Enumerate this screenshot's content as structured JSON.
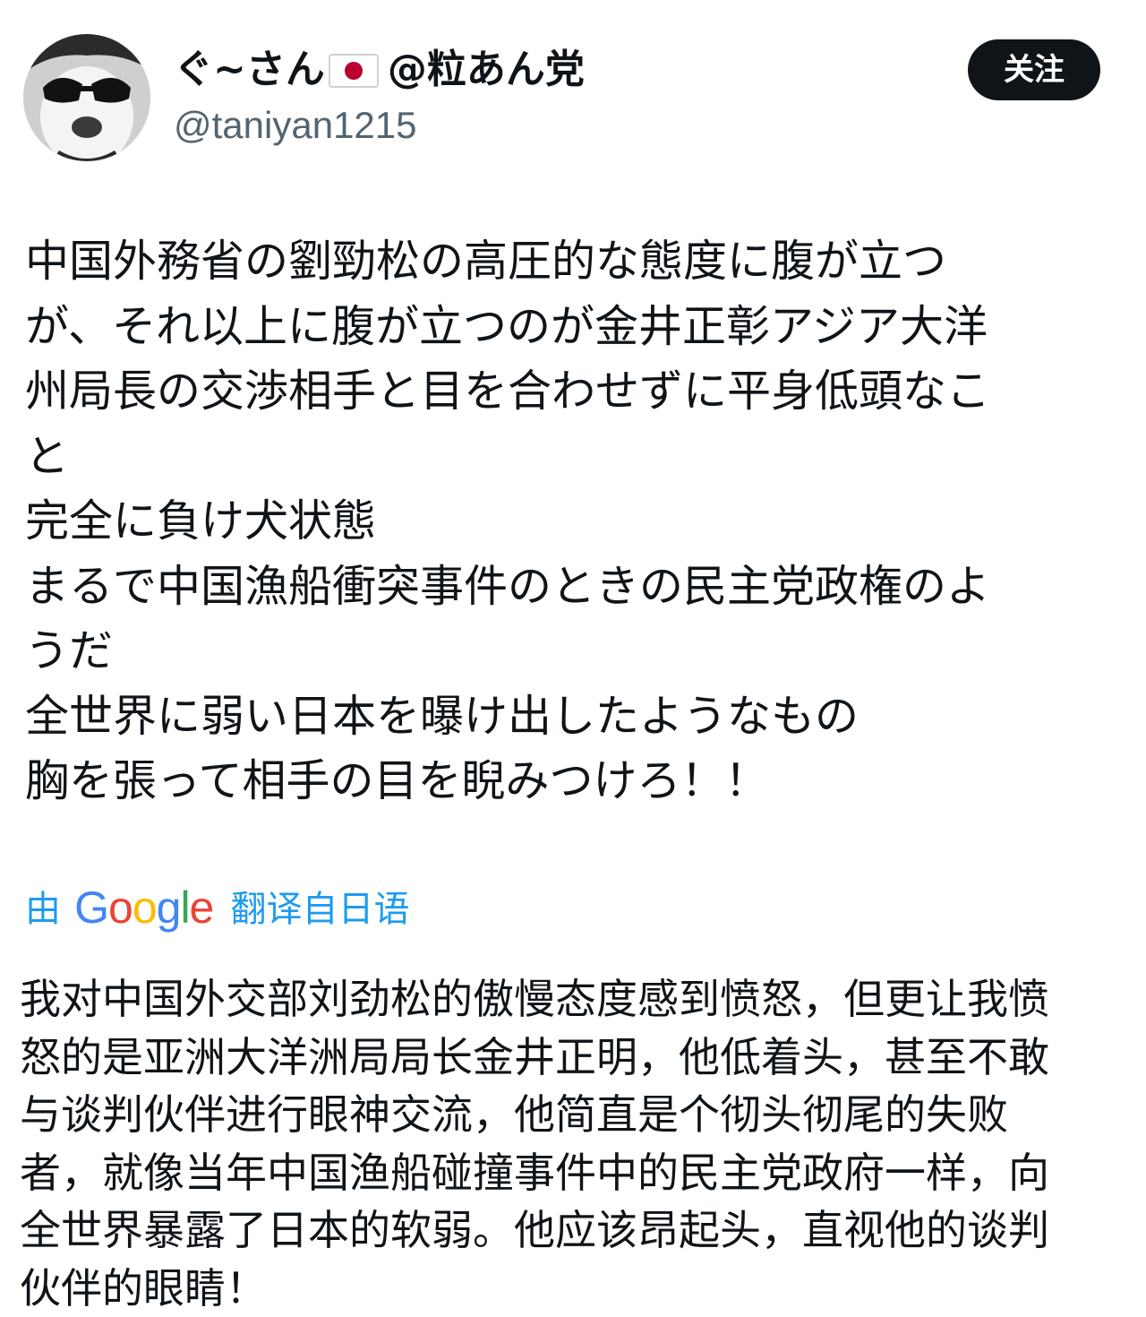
{
  "author": {
    "display_name": "ぐ~さん",
    "flag_icon": "japan-flag-icon",
    "display_name_suffix": "@粒あん党",
    "handle": "@taniyan1215",
    "avatar_icon": "dog-with-sunglasses-avatar"
  },
  "follow_button": {
    "label": "关注"
  },
  "post": {
    "lines": [
      "中国外務省の劉勁松の高圧的な態度に腹が立つ",
      "が、それ以上に腹が立つのが金井正彰アジア大洋",
      "州局長の交渉相手と目を合わせずに平身低頭なこ",
      "と",
      "完全に負け犬状態",
      "まるで中国漁船衝突事件のときの民主党政権のよ",
      "うだ",
      "全世界に弱い日本を曝け出したようなもの",
      "胸を張って相手の目を睨みつけろ！！"
    ]
  },
  "translation": {
    "by_label": "由",
    "provider": "Google",
    "from_label": "翻译自日语",
    "link_color": "#1d9bf0",
    "google_colors": [
      "#4285F4",
      "#EA4335",
      "#FBBC05",
      "#4285F4",
      "#34A853",
      "#EA4335"
    ],
    "lines": [
      "我对中国外交部刘劲松的傲慢态度感到愤怒，但更让我愤",
      "怒的是亚洲大洋洲局局长金井正明，他低着头，甚至不敢",
      "与谈判伙伴进行眼神交流，他简直是个彻头彻尾的失败",
      "者，就像当年中国渔船碰撞事件中的民主党政府一样，向",
      "全世界暴露了日本的软弱。他应该昂起头，直视他的谈判",
      "伙伴的眼睛！"
    ]
  }
}
